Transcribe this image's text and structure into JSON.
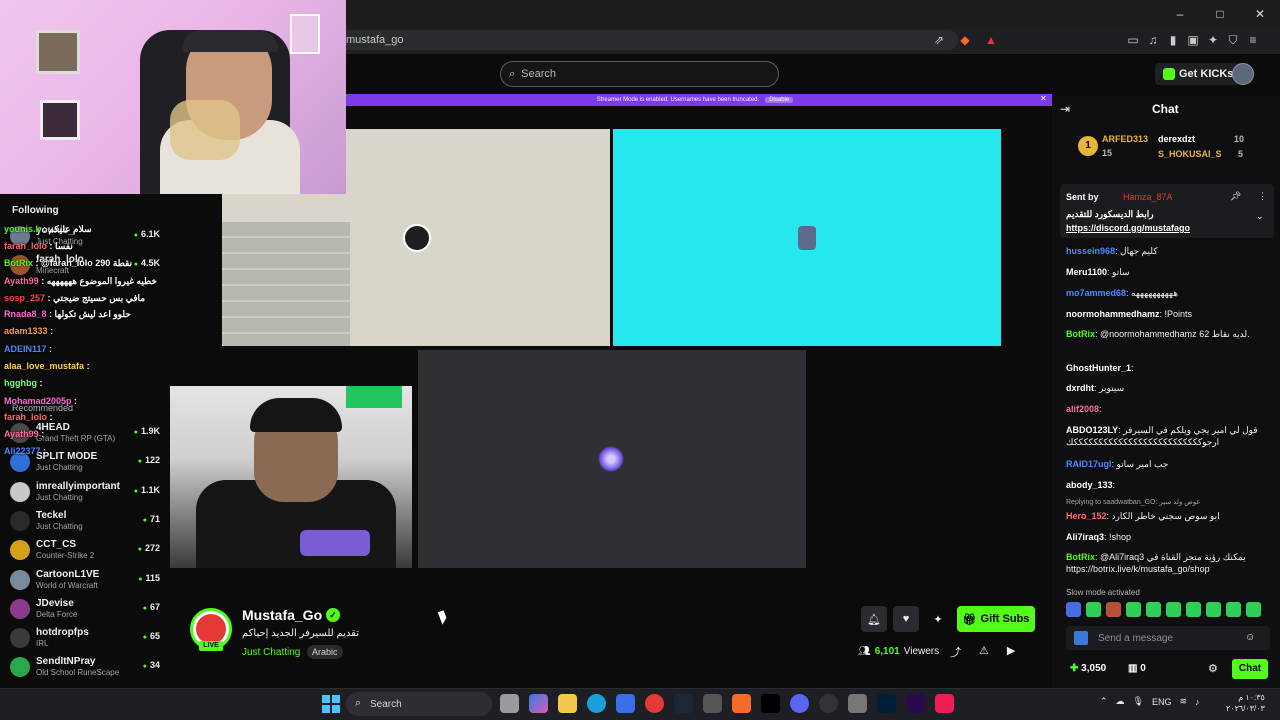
{
  "browser": {
    "url": "mustafa_go",
    "window_controls": [
      "–",
      "□",
      "✕"
    ]
  },
  "header": {
    "search_placeholder": "Search",
    "get_kicks_label": "Get KICKs"
  },
  "banner": {
    "text": "Streamer Mode is enabled. Usernames have been truncated.",
    "disable_label": "Disable"
  },
  "sidebar": {
    "following_label": "Following",
    "recommended_label": "Recommended",
    "following": [
      {
        "name": "younis_",
        "category": "Just Chatting",
        "count": "6.1K",
        "color": "#6b7a8f"
      },
      {
        "name": "farah_lolo",
        "category": "Minecraft",
        "count": "4.5K",
        "color": "#a0522d"
      }
    ],
    "recommended": [
      {
        "name": "4HEAD",
        "category": "Grand Theft RP (GTA)",
        "count": "1.9K",
        "color": "#4a4a4a"
      },
      {
        "name": "SPLIT MODE",
        "category": "Just Chatting",
        "count": "122",
        "color": "#2e6fd8"
      },
      {
        "name": "imreallyimportant",
        "category": "Just Chatting",
        "count": "1.1K",
        "color": "#c9c9c9"
      },
      {
        "name": "Teckel",
        "category": "Just Chatting",
        "count": "71",
        "color": "#2a2a2a"
      },
      {
        "name": "CCT_CS",
        "category": "Counter-Strike 2",
        "count": "272",
        "color": "#d4a017"
      },
      {
        "name": "CartoonL1VE",
        "category": "World of Warcraft",
        "count": "115",
        "color": "#7a8a9a"
      },
      {
        "name": "JDevise",
        "category": "Delta Force",
        "count": "67",
        "color": "#8b3a8b"
      },
      {
        "name": "hotdropfps",
        "category": "IRL",
        "count": "65",
        "color": "#3a3a3a"
      },
      {
        "name": "SendItNPray",
        "category": "Old School RuneScape",
        "count": "34",
        "color": "#2aa84a"
      }
    ]
  },
  "overlay_chat": [
    {
      "user": "younis.k",
      "msg": ": سلام عليكم",
      "color": "#53fc18"
    },
    {
      "user": "farah_lolo",
      "msg": ": نفسا",
      "color": "#ff6b6b"
    },
    {
      "user": "BotRix",
      "msg": ": @farah_lolo 290 نقطة",
      "color": "#53fc18"
    },
    {
      "user": "Ayath99",
      "msg": ": خطيه غيروا الموضوع ههههههه",
      "color": "#ff6b9a"
    },
    {
      "user": "sosp_257",
      "msg": ": مافي بس حسيتج ضيجتي",
      "color": "#ff4444"
    },
    {
      "user": "Rnada8_8",
      "msg": ": حلوو اعد ليش تكولها",
      "color": "#ff6bd6"
    },
    {
      "user": "adam1333",
      "msg": ":",
      "color": "#ff9a3c"
    },
    {
      "user": "ADEIN117",
      "msg": ":",
      "color": "#4a8aff"
    },
    {
      "user": "alaa_love_mustafa",
      "msg": ":",
      "color": "#ffd34a"
    },
    {
      "user": "hgghbg",
      "msg": ":",
      "color": "#7aff7a"
    },
    {
      "user": "Mohamad2005p",
      "msg": ":",
      "color": "#ff6bd6"
    },
    {
      "user": "farah_lolo",
      "msg": ":",
      "color": "#ff6b6b"
    },
    {
      "user": "Ayath99",
      "msg": ":",
      "color": "#ff6b9a"
    },
    {
      "user": "Ali22377",
      "msg": ":",
      "color": "#4a8aff"
    }
  ],
  "channel": {
    "name": "Mustafa_Go",
    "live_label": "LIVE",
    "title": "تقديم للسيرفر الجديد إحياكم",
    "category": "Just Chatting",
    "tag": "Arabic",
    "gift_label": "Gift Subs",
    "viewers_count": "6,101",
    "viewers_label": "Viewers"
  },
  "chat": {
    "title": "Chat",
    "leaderboard": [
      {
        "name": "ARFED313",
        "value": "15",
        "color": "#e8b53a"
      },
      {
        "name": "derexdzt",
        "value": "10",
        "color": "#ffffff"
      },
      {
        "name": "S_HOKUSAI_S",
        "value": "5",
        "color": "#e8b53a"
      }
    ],
    "pinned": {
      "sent_by_label": "Sent by",
      "user": "Hamza_87A",
      "text": "رابط الديسكورد للتقديم",
      "link": "https://discord.gg/mustafago"
    },
    "messages": [
      {
        "user": "hussein968",
        "text": ": كليم جهال",
        "color": "#4a8aff"
      },
      {
        "user": "Meru1100",
        "text": ": ساتو",
        "color": "#ffffff"
      },
      {
        "user": "mo7ammed68",
        "text": ": ههههههههههه",
        "color": "#4a8aff"
      },
      {
        "user": "noormohammedhamz",
        "text": ": !Points",
        "color": "#ffffff"
      },
      {
        "user": "BotRix",
        "text": ": @noormohammedhamz لديه نقاط 62.",
        "color": "#53fc18"
      },
      {
        "user": "GhostHunter_1",
        "text": ":",
        "color": "#ffffff"
      },
      {
        "user": "dxrdht",
        "text": ": سيتوبر",
        "color": "#ffffff"
      },
      {
        "user": "alif2008",
        "text": ":",
        "color": "#ff6b9a"
      },
      {
        "user": "ABDO123LY",
        "text": ": قول لي امير يجي ويلكم في السيرفر ارجوككككككككككككككككككككككككككك",
        "color": "#ffffff"
      },
      {
        "user": "RAID17ugl",
        "text": ": جب امير ساتو",
        "color": "#4a8aff"
      },
      {
        "user": "abody_133",
        "text": ":",
        "color": "#ffffff"
      },
      {
        "user": "Hero_152",
        "text": ": ابو سوص سجني خاطر الكارد",
        "color": "#ff6b6b"
      },
      {
        "user": "Ali7iraq3",
        "text": ": !shop",
        "color": "#ffffff"
      },
      {
        "user": "BotRix",
        "text": ": @Ali7iraq3 يمكنك رؤية متجر القناة في https://botrix.live/k/mustafa_go/shop",
        "color": "#53fc18"
      }
    ],
    "reply_note": "Replying to saadwatban_GO: عوض ولد سير",
    "slow_mode": "Slow mode activated",
    "input_placeholder": "Send a message",
    "points": "3,050",
    "drops": "0",
    "chat_button": "Chat"
  },
  "taskbar": {
    "search_label": "Search",
    "lang": "ENG",
    "time": "١٠:٣٥ م",
    "date": "٢٠٢٦/٠٣/٠٣"
  }
}
